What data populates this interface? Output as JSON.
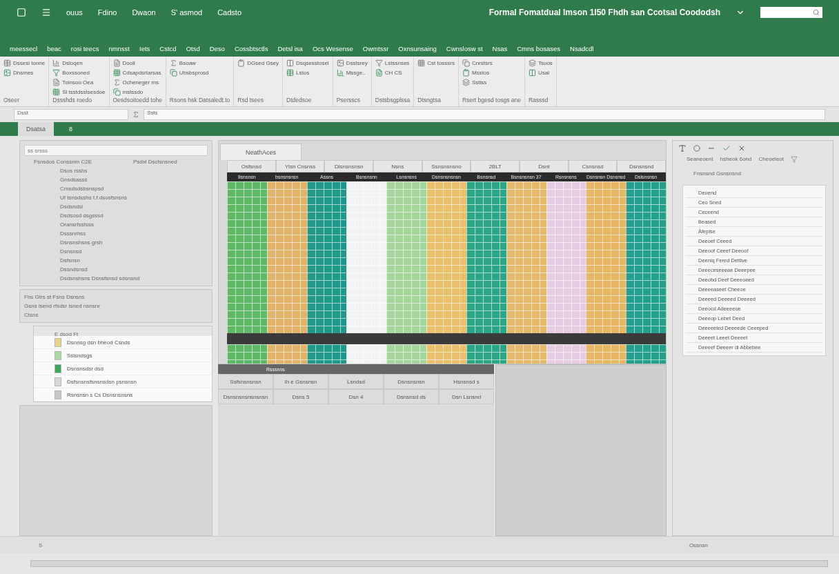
{
  "title_bar": {
    "quick_items": [
      "ouus",
      "Fdino",
      "Dwaon",
      "S' asmod"
    ],
    "title": "Formal Fomatdual Imson 1l50 Fhdh san Ccotsal Coododsh",
    "sub_label": "Cadsto"
  },
  "tabs": [
    "meessecl",
    "beac",
    "rosi teecs",
    "nmnsst",
    "Iets",
    "Cstcd",
    "Otsd",
    "Deso",
    "Cossbtsctls",
    "Detsl isa",
    "Ocs Wesense",
    "Owmtssr",
    "Oxnsunsaing",
    "Cwnslosw st",
    "Nsas",
    "Cmns bosases",
    "Nsadcdl"
  ],
  "ribbon": [
    {
      "label": "Oseer",
      "items": [
        "Dssesl tonne",
        "Dhsmes"
      ]
    },
    {
      "label": "Dssshds roedo",
      "items": [
        "Dsloqen",
        "Boxssoned",
        "Toinsoo Oea",
        "Sl tsstdsstsesdoe"
      ]
    },
    {
      "label": "Oesdsoitoedd tohe",
      "items": [
        "Dooll",
        "Cdsapdsrtarsas",
        "Ocheneger ms",
        "mstssdo"
      ]
    },
    {
      "label": "Rsons hsk Datsaledt.to",
      "items": [
        "Bsoaw",
        "Ubsbsprosd"
      ]
    },
    {
      "label": "Rsd tsees",
      "items": [
        "DGsed Gsey"
      ]
    },
    {
      "label": "Dtdedsoe",
      "items": [
        "Dsqsesstosel",
        "Lstos"
      ]
    },
    {
      "label": "Psersscs",
      "items": [
        "Dsstsrey",
        "Mssge.."
      ]
    },
    {
      "label": "Dstsbsgplssa",
      "items": [
        "Lstssnses",
        "CH CS"
      ]
    },
    {
      "label": "Dtsngtsa",
      "items": [
        "Cst tosssrs"
      ]
    },
    {
      "label": "Rsert bgesd tosgs ane",
      "items": [
        "Cnrstsrs",
        "Msstos",
        "Sstiss"
      ]
    },
    {
      "label": "Rasssd",
      "items": [
        "Tsuos",
        "Usal"
      ]
    }
  ],
  "formula_bar": {
    "name_box": "Dsst",
    "content": "Ssts"
  },
  "sheet_tabs": [
    "Dsatsa",
    "8"
  ],
  "left_panel": {
    "search": "ss srsss",
    "header": [
      "Fsnsdos Conssnm C2E",
      "Psdxl Dsctsnsned"
    ],
    "items": [
      "Dsos rsshs",
      "Gnsdsasss",
      "Cmsdsdsbsnspsd",
      "Uf tsnsdsshs t.f.dsosfsnsns",
      "Dsdsndsi",
      "Dsdsosd dsgsssd",
      "Oransrfsstsss",
      "Dsssnrhss",
      "Dsnsnshsns grsh",
      "Dsnsnsd",
      "Dsfsnsn",
      "Dssndsnsd",
      "Dsdsnshsns Dsnsfsnsd sdsnsnd"
    ]
  },
  "dialog": {
    "title": "Fhs Gtrs st Fsns Dsnsns",
    "text": "Gsns lsend rfsdsr lsned nsnsnr",
    "link": "Ctsns"
  },
  "popup": {
    "header": "E dsod Ft",
    "items": [
      {
        "text": "Dsnnsg dsn bheod Csnds",
        "color": "#e9d38a"
      },
      {
        "text": "Sslsndsgs",
        "color": "#a9d8a0"
      },
      {
        "text": "Dsnsnsdsr dsd",
        "color": "#3fa55a"
      },
      {
        "text": "Dsfsnsnsfsnsnsdsn psnsnsn",
        "color": "#d6d6d6"
      },
      {
        "text": "Rsnsnsn s Cs Dsnsnsnsns",
        "color": "#c8c8c8"
      }
    ]
  },
  "grid": {
    "tab": "NeathAces",
    "top_headers": [
      "Osfsnsd",
      "Ylsn Cnsnss",
      "Dlsnsnsnsn",
      "Nsns",
      "Ssnsnsnsno",
      "2BLT",
      "Dsnt",
      "Csnsnsd",
      "Dsnsnsnd"
    ],
    "columns": [
      {
        "header": "Ilsnsnsn",
        "color": "#5fb866"
      },
      {
        "header": "bsnsnsnsn",
        "color": "#e3b36a"
      },
      {
        "header": "Assns",
        "color": "#1f9a8a"
      },
      {
        "header": "Bsnsnsnn",
        "color": "#f3f3f3"
      },
      {
        "header": "Lsnsnsns",
        "color": "#a5d69a"
      },
      {
        "header": "Dsnsnsnsnsn",
        "color": "#ecbf6c"
      },
      {
        "header": "Bsnsnsd",
        "color": "#2ba586"
      },
      {
        "header": "Bsnsnsnsn 37",
        "color": "#e8b96a"
      },
      {
        "header": "Rsnsnsns",
        "color": "#e7cbe2"
      },
      {
        "header": "Dsnsnsn Dsnsnsd",
        "color": "#e9b664"
      },
      {
        "header": "Dslsnsnsn",
        "color": "#23a08b"
      }
    ]
  },
  "lower_table": {
    "title": "Rsssnns",
    "columns": [
      "Ssfsnsnsnsn",
      "Ih e Gsnsnsn",
      "Lsndsd",
      "Dsnsnsnsn",
      "Hsnsnsd s"
    ],
    "rows": [
      [
        "Dsnsnsnsnsnsnsn",
        "Dsns 5",
        "Dsn 4",
        "Dsnsnsd ds",
        "Dsn Lsnsnd"
      ]
    ]
  },
  "right_panel": {
    "header": [
      "Seaneoent",
      "hsheok 6ond",
      "Cheoeleot"
    ],
    "subheader": "Fnsnsnd Gsnsnsnd",
    "rows": [
      "Deoend",
      "Ceo Sned",
      "Ceceend",
      "Beased",
      "Afeplse",
      "Deeoef Ceeed",
      "Deeoof Ceeef Deeoof",
      "Deeniq Fered Dettive",
      "Deeeceseeeae Deeepee",
      "Deeobd Deef Deeeoned",
      "Deeeeaseet Cheeoe",
      "Deeeed Deeeed Deeeed",
      "Deeocd Adeeeeoe",
      "Deeeop Lebet Deed",
      "Deeeeeled Deeeede Ceeeped",
      "Deeeet Leeet Deeeet",
      "Deeeef Deeeer di Abbebee"
    ]
  },
  "status_bar": {
    "left": "S",
    "right": "Ossnsn"
  }
}
